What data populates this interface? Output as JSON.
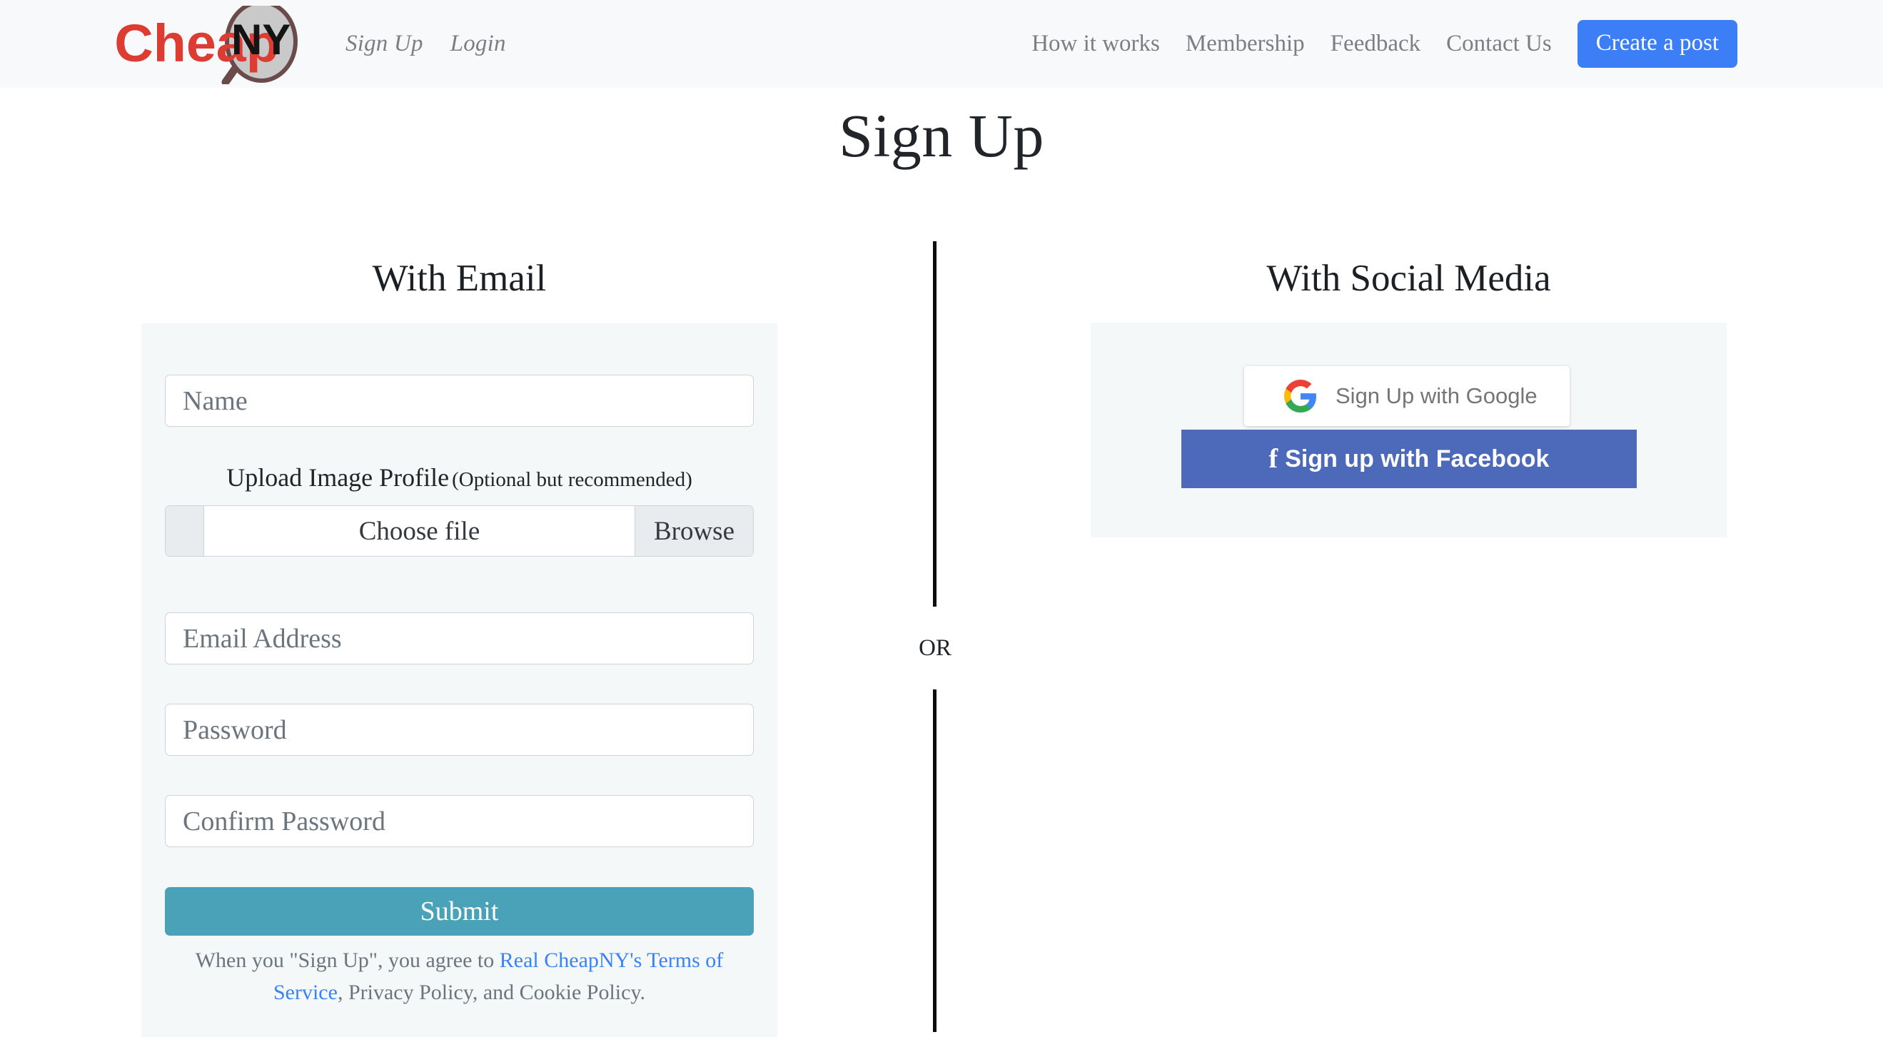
{
  "header": {
    "logo": {
      "name": "CheapNY",
      "word": "Cheap",
      "badge": "NY",
      "word_color": "#dc3c32",
      "badge_color": "#141414"
    },
    "left_nav": [
      {
        "label": "Sign Up"
      },
      {
        "label": "Login"
      }
    ],
    "right_nav": [
      {
        "label": "How it works"
      },
      {
        "label": "Membership"
      },
      {
        "label": "Feedback"
      },
      {
        "label": "Contact Us"
      }
    ],
    "cta": {
      "label": "Create a post",
      "color": "#3b7ef5"
    }
  },
  "page": {
    "title": "Sign Up"
  },
  "email_section": {
    "heading": "With Email",
    "fields": {
      "name_placeholder": "Name",
      "email_placeholder": "Email Address",
      "password_placeholder": "Password",
      "confirm_placeholder": "Confirm Password"
    },
    "upload": {
      "label_main": "Upload Image Profile",
      "label_sub": "(Optional but recommended)",
      "chosen_text": "Choose file",
      "browse_label": "Browse"
    },
    "submit": {
      "label": "Submit",
      "color": "#4aa2b8"
    },
    "terms": {
      "before": "When you \"Sign Up\", you agree to ",
      "link": "Real CheapNY's Terms of Service",
      "after": ", Privacy Policy, and Cookie Policy.",
      "link_color": "#3b82f6"
    }
  },
  "divider": {
    "or_label": "OR"
  },
  "social_section": {
    "heading": "With Social Media",
    "google": {
      "label": "Sign Up with Google",
      "icon": "google-g-icon"
    },
    "facebook": {
      "label": "Sign up with Facebook",
      "icon": "facebook-f-icon",
      "color": "#4c69ba"
    }
  }
}
